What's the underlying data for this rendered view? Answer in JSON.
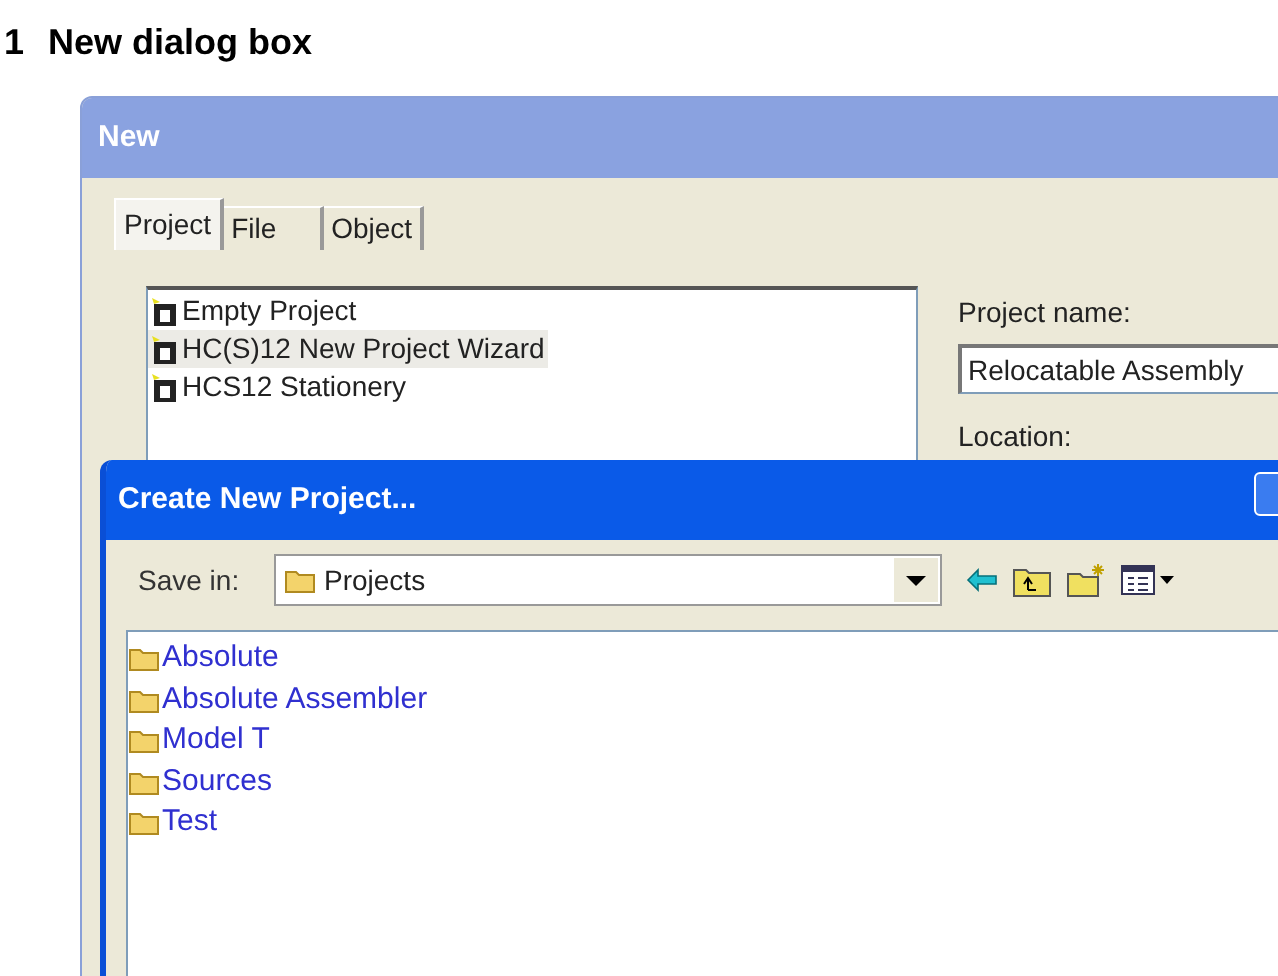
{
  "caption": {
    "number": "1",
    "title": "New dialog box"
  },
  "new_dialog": {
    "title": "New",
    "tabs": [
      {
        "label": "Project",
        "selected": true
      },
      {
        "label": "File",
        "selected": false
      },
      {
        "label": "Object",
        "selected": false
      }
    ],
    "templates": [
      {
        "label": "Empty Project",
        "selected": false
      },
      {
        "label": "HC(S)12 New Project Wizard",
        "selected": true
      },
      {
        "label": "HCS12 Stationery",
        "selected": false
      }
    ],
    "project_name_label": "Project name:",
    "project_name_value": "Relocatable Assembly",
    "location_label": "Location:"
  },
  "create_dialog": {
    "title": "Create New Project...",
    "save_in_label": "Save in:",
    "save_in_value": "Projects",
    "folders": [
      {
        "label": "Absolute"
      },
      {
        "label": "Absolute Assembler"
      },
      {
        "label": "Model T"
      },
      {
        "label": "Sources"
      },
      {
        "label": "Test"
      }
    ]
  }
}
